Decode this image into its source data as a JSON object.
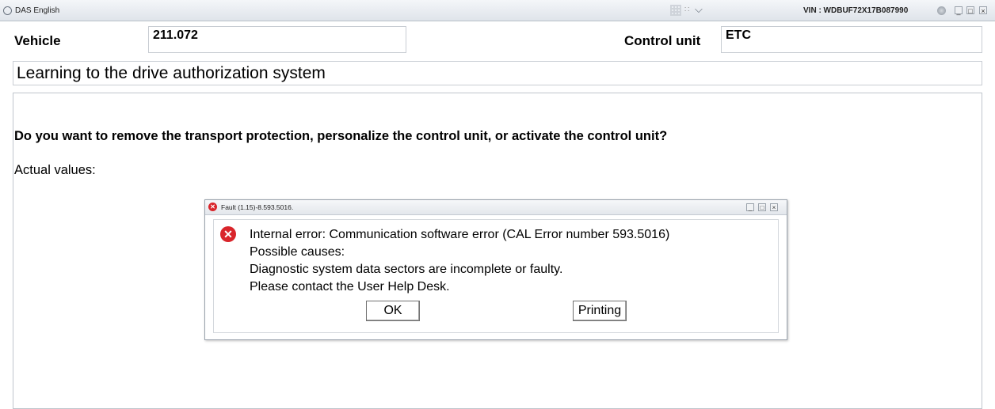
{
  "window": {
    "app_title": "DAS English",
    "toolbar_mark": "∷",
    "vin": "VIN : WDBUF72X17B087990",
    "controls": [
      "_",
      "□",
      "×"
    ]
  },
  "header": {
    "vehicle_label": "Vehicle",
    "vehicle_value": "211.072",
    "control_unit_label": "Control unit",
    "control_unit_value": "ETC"
  },
  "page_title": "Learning to the drive authorization system",
  "content": {
    "question": "Do you want to remove the transport protection, personalize the control unit, or activate the control unit?",
    "actual_values_label": "Actual values:"
  },
  "dialog": {
    "title": "Fault (1.15)-8.593.5016.",
    "message_lines": [
      "Internal error: Communication software error (CAL Error number 593.5016)",
      "Possible causes:",
      "Diagnostic system data sectors are incomplete or faulty.",
      "Please contact the User Help Desk."
    ],
    "ok_label": "OK",
    "print_label": "Printing",
    "controls": [
      "_",
      "□",
      "×"
    ]
  }
}
